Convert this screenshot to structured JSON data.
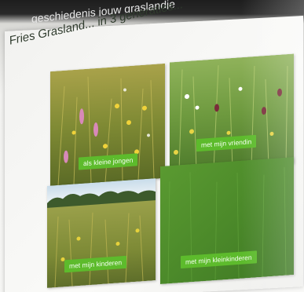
{
  "slide": {
    "top_text": "geschiedenis jouw graslandje",
    "title": "Fries Grasland... in 3 generaties...",
    "tiles": [
      {
        "label": "als kleine jongen",
        "scene": "wildflower-meadow"
      },
      {
        "label": "met mijn vriendin",
        "scene": "flower-rich-grassland"
      },
      {
        "label": "met mijn kinderen",
        "scene": "meadow-with-treeline"
      },
      {
        "label": "met mijn kleinkinderen",
        "scene": "uniform-green-grass"
      }
    ],
    "colors": {
      "label_bg": "#5dbb2c",
      "label_text": "#f4fff0",
      "title_text": "#2f3b2d"
    }
  }
}
